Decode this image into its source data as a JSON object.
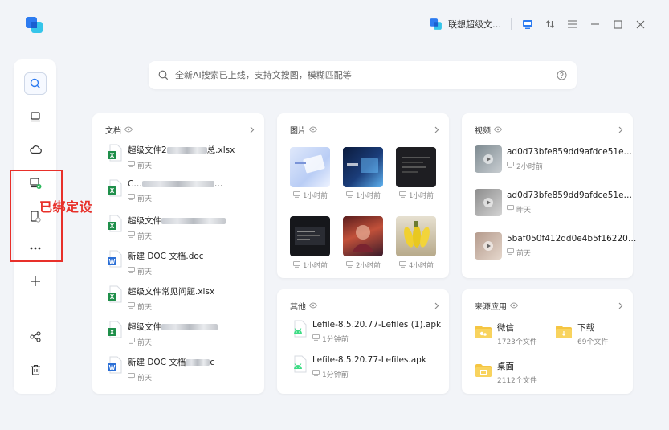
{
  "topbar": {
    "account_name": "联想超级文…",
    "icons": [
      "monitor-icon",
      "transfer-icon",
      "menu-icon",
      "minimize-icon",
      "maximize-icon",
      "close-icon"
    ]
  },
  "sidebar": {
    "items": [
      "search-icon",
      "computer-icon",
      "cloud-icon",
      "bound-pc-icon",
      "bound-phone-icon",
      "more-icon",
      "add-icon",
      "share-icon",
      "trash-icon"
    ]
  },
  "annotation": {
    "label": "已绑定设备",
    "color": "#e8302a"
  },
  "search": {
    "placeholder": "全新AI搜索已上线，支持文搜图，模糊匹配等"
  },
  "documents": {
    "title": "文档",
    "items": [
      {
        "name_prefix": "超级文件2",
        "name_suffix": "总.xlsx",
        "time": "前天",
        "type": "excel"
      },
      {
        "name_prefix": "C…",
        "name_suffix": "…",
        "time": "前天",
        "type": "excel"
      },
      {
        "name_prefix": "超级文件",
        "name_suffix": "",
        "time": "前天",
        "type": "excel"
      },
      {
        "name_prefix": "新建 DOC 文档.doc",
        "name_suffix": "",
        "time": "前天",
        "type": "word"
      },
      {
        "name_prefix": "超级文件常见问题.xlsx",
        "name_suffix": "",
        "time": "前天",
        "type": "excel"
      },
      {
        "name_prefix": "超级文件",
        "name_suffix": "",
        "time": "前天",
        "type": "excel"
      },
      {
        "name_prefix": "新建 DOC 文档",
        "name_suffix": "c",
        "time": "前天",
        "type": "word"
      }
    ]
  },
  "images": {
    "title": "图片",
    "items": [
      {
        "time": "1小时前"
      },
      {
        "time": "1小时前"
      },
      {
        "time": "1小时前"
      },
      {
        "time": "1小时前"
      },
      {
        "time": "2小时前"
      },
      {
        "time": "4小时前"
      }
    ]
  },
  "videos": {
    "title": "视频",
    "items": [
      {
        "name": "ad0d73bfe859dd9afdce51e…",
        "time": "2小时前"
      },
      {
        "name": "ad0d73bfe859dd9afdce51e…",
        "time": "昨天"
      },
      {
        "name": "5baf050f412dd0e4b5f16220…",
        "time": "前天"
      }
    ]
  },
  "others": {
    "title": "其他",
    "items": [
      {
        "name": "Lefile-8.5.20.77-Lefiles (1).apk",
        "time": "1分钟前"
      },
      {
        "name": "Lefile-8.5.20.77-Lefiles.apk",
        "time": "1分钟前"
      }
    ]
  },
  "sources": {
    "title": "来源应用",
    "items": [
      {
        "name": "微信",
        "count": "1723个文件"
      },
      {
        "name": "下载",
        "count": "69个文件"
      },
      {
        "name": "桌面",
        "count": "2112个文件"
      }
    ]
  }
}
